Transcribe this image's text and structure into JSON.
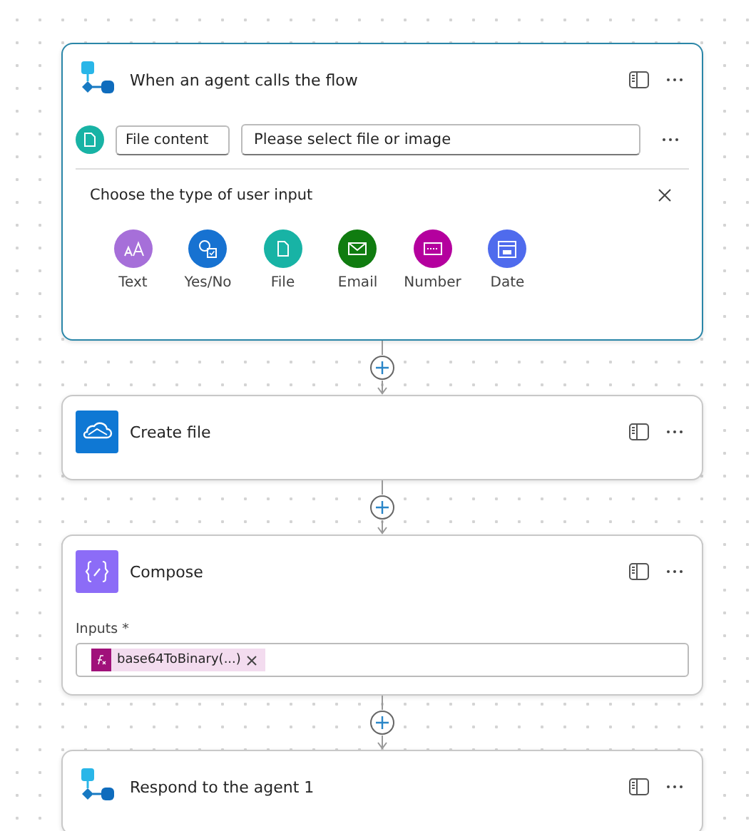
{
  "steps": [
    {
      "kind": "trigger",
      "title": "When an agent calls the flow",
      "selected": true,
      "parameter": {
        "name": "File content",
        "placeholder": "Please select file or image"
      },
      "chooser": {
        "title": "Choose the type of user input",
        "types": [
          {
            "kind": "text",
            "label": "Text",
            "color": "#a66fd9"
          },
          {
            "kind": "yesno",
            "label": "Yes/No",
            "color": "#1772d1"
          },
          {
            "kind": "file",
            "label": "File",
            "color": "#18b3a5"
          },
          {
            "kind": "email",
            "label": "Email",
            "color": "#107c10"
          },
          {
            "kind": "number",
            "label": "Number",
            "color": "#b4009e"
          },
          {
            "kind": "date",
            "label": "Date",
            "color": "#4f6bed"
          }
        ]
      }
    },
    {
      "kind": "create-file",
      "title": "Create file",
      "selected": false
    },
    {
      "kind": "compose",
      "title": "Compose",
      "selected": false,
      "inputs": {
        "label": "Inputs *",
        "token": "base64ToBinary(...)"
      }
    },
    {
      "kind": "respond",
      "title": "Respond to the agent 1",
      "selected": false
    }
  ]
}
